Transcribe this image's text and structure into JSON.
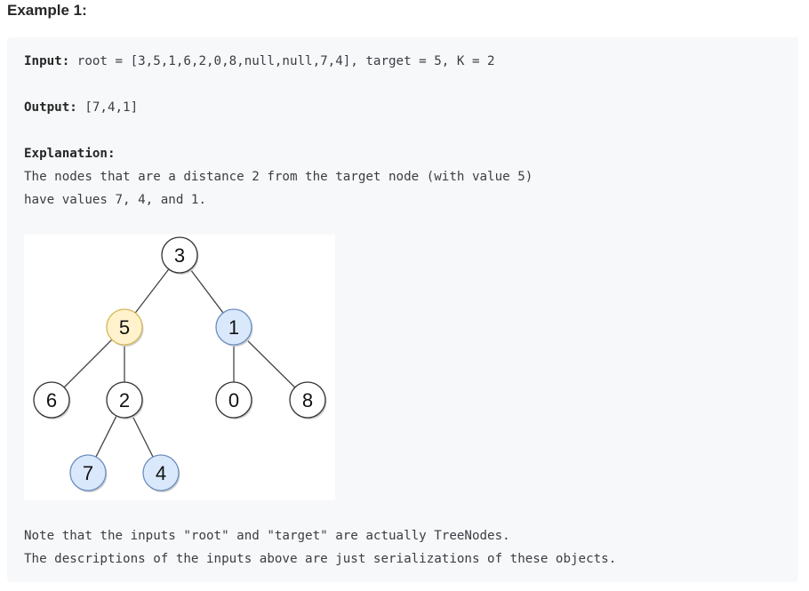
{
  "heading": "Example 1:",
  "input": {
    "label": "Input:",
    "value": "root = [3,5,1,6,2,0,8,null,null,7,4], target = 5, K = 2"
  },
  "output": {
    "label": "Output:",
    "value": "[7,4,1]"
  },
  "explanation": {
    "label": "Explanation:",
    "lines": [
      "The nodes that are a distance 2 from the target node (with value 5)",
      "have values 7, 4, and 1."
    ]
  },
  "tree": {
    "colors": {
      "default": "#ffffff",
      "target": "#fff2cc",
      "result": "#dae8fc",
      "target_stroke": "#d6b656",
      "result_stroke": "#6c8ebf",
      "default_stroke": "#333333"
    },
    "nodes": [
      {
        "value": "3",
        "state": "default"
      },
      {
        "value": "5",
        "state": "target"
      },
      {
        "value": "1",
        "state": "result"
      },
      {
        "value": "6",
        "state": "default"
      },
      {
        "value": "2",
        "state": "default"
      },
      {
        "value": "0",
        "state": "default"
      },
      {
        "value": "8",
        "state": "default"
      },
      {
        "value": "7",
        "state": "result"
      },
      {
        "value": "4",
        "state": "result"
      }
    ],
    "edges": [
      [
        "3",
        "5"
      ],
      [
        "3",
        "1"
      ],
      [
        "5",
        "6"
      ],
      [
        "5",
        "2"
      ],
      [
        "1",
        "0"
      ],
      [
        "1",
        "8"
      ],
      [
        "2",
        "7"
      ],
      [
        "2",
        "4"
      ]
    ]
  },
  "notes": [
    "Note that the inputs \"root\" and \"target\" are actually TreeNodes.",
    "The descriptions of the inputs above are just serializations of these objects."
  ]
}
